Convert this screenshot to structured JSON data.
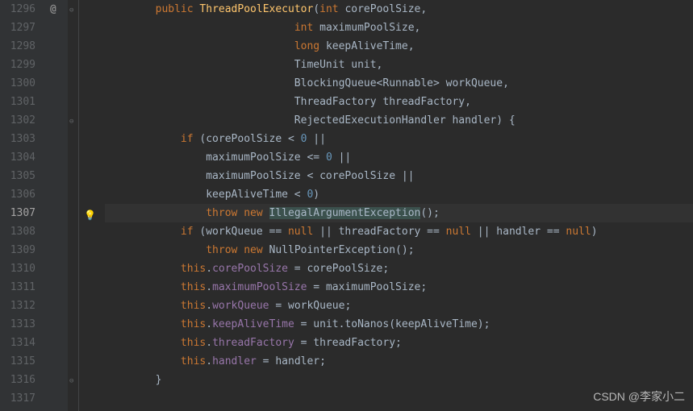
{
  "watermark": "CSDN @李家小二",
  "at_symbol": "@",
  "bulb_line": 1307,
  "current_line": 1307,
  "fold_marks": [
    {
      "line": 1296,
      "glyph": "⊖"
    },
    {
      "line": 1302,
      "glyph": "⊖"
    },
    {
      "line": 1316,
      "glyph": "⊖"
    }
  ],
  "lines": [
    {
      "n": 1296,
      "tokens": [
        [
          "",
          "        "
        ],
        [
          "kw",
          "public"
        ],
        [
          "",
          " "
        ],
        [
          "fn",
          "ThreadPoolExecutor"
        ],
        [
          "",
          "("
        ],
        [
          "kw",
          "int"
        ],
        [
          "",
          " corePoolSize"
        ],
        [
          "str",
          ","
        ]
      ]
    },
    {
      "n": 1297,
      "tokens": [
        [
          "",
          "                              "
        ],
        [
          "kw",
          "int"
        ],
        [
          "",
          " maximumPoolSize"
        ],
        [
          "str",
          ","
        ]
      ]
    },
    {
      "n": 1298,
      "tokens": [
        [
          "",
          "                              "
        ],
        [
          "kw",
          "long"
        ],
        [
          "",
          " keepAliveTime"
        ],
        [
          "str",
          ","
        ]
      ]
    },
    {
      "n": 1299,
      "tokens": [
        [
          "",
          "                              TimeUnit unit"
        ],
        [
          "str",
          ","
        ]
      ]
    },
    {
      "n": 1300,
      "tokens": [
        [
          "",
          "                              BlockingQueue<Runnable> workQueue"
        ],
        [
          "str",
          ","
        ]
      ]
    },
    {
      "n": 1301,
      "tokens": [
        [
          "",
          "                              ThreadFactory threadFactory"
        ],
        [
          "str",
          ","
        ]
      ]
    },
    {
      "n": 1302,
      "tokens": [
        [
          "",
          "                              RejectedExecutionHandler handler) {"
        ]
      ]
    },
    {
      "n": 1303,
      "tokens": [
        [
          "",
          "            "
        ],
        [
          "kw",
          "if"
        ],
        [
          "",
          " (corePoolSize < "
        ],
        [
          "nm",
          "0"
        ],
        [
          "",
          " ||"
        ]
      ]
    },
    {
      "n": 1304,
      "tokens": [
        [
          "",
          "                maximumPoolSize <= "
        ],
        [
          "nm",
          "0"
        ],
        [
          "",
          " ||"
        ]
      ]
    },
    {
      "n": 1305,
      "tokens": [
        [
          "",
          "                maximumPoolSize < corePoolSize ||"
        ]
      ]
    },
    {
      "n": 1306,
      "tokens": [
        [
          "",
          "                keepAliveTime < "
        ],
        [
          "nm",
          "0"
        ],
        [
          "",
          ")"
        ]
      ]
    },
    {
      "n": 1307,
      "tokens": [
        [
          "",
          "                "
        ],
        [
          "kw",
          "throw new"
        ],
        [
          "",
          " "
        ],
        [
          "hlw",
          "IllegalArgumentException"
        ],
        [
          "",
          "()"
        ],
        [
          "str",
          ";"
        ]
      ]
    },
    {
      "n": 1308,
      "tokens": [
        [
          "",
          "            "
        ],
        [
          "kw",
          "if"
        ],
        [
          "",
          " (workQueue == "
        ],
        [
          "kw",
          "null"
        ],
        [
          "",
          " || threadFactory == "
        ],
        [
          "kw",
          "null"
        ],
        [
          "",
          " || handler == "
        ],
        [
          "kw",
          "null"
        ],
        [
          "",
          ")"
        ]
      ]
    },
    {
      "n": 1309,
      "tokens": [
        [
          "",
          "                "
        ],
        [
          "kw",
          "throw new"
        ],
        [
          "",
          " NullPointerException()"
        ],
        [
          "str",
          ";"
        ]
      ]
    },
    {
      "n": 1310,
      "tokens": [
        [
          "",
          "            "
        ],
        [
          "kw",
          "this"
        ],
        [
          "",
          "."
        ],
        [
          "fld",
          "corePoolSize"
        ],
        [
          "",
          " = corePoolSize"
        ],
        [
          "str",
          ";"
        ]
      ]
    },
    {
      "n": 1311,
      "tokens": [
        [
          "",
          "            "
        ],
        [
          "kw",
          "this"
        ],
        [
          "",
          "."
        ],
        [
          "fld",
          "maximumPoolSize"
        ],
        [
          "",
          " = maximumPoolSize"
        ],
        [
          "str",
          ";"
        ]
      ]
    },
    {
      "n": 1312,
      "tokens": [
        [
          "",
          "            "
        ],
        [
          "kw",
          "this"
        ],
        [
          "",
          "."
        ],
        [
          "fld",
          "workQueue"
        ],
        [
          "",
          " = workQueue"
        ],
        [
          "str",
          ";"
        ]
      ]
    },
    {
      "n": 1313,
      "tokens": [
        [
          "",
          "            "
        ],
        [
          "kw",
          "this"
        ],
        [
          "",
          "."
        ],
        [
          "fld",
          "keepAliveTime"
        ],
        [
          "",
          " = unit.toNanos(keepAliveTime)"
        ],
        [
          "str",
          ";"
        ]
      ]
    },
    {
      "n": 1314,
      "tokens": [
        [
          "",
          "            "
        ],
        [
          "kw",
          "this"
        ],
        [
          "",
          "."
        ],
        [
          "fld",
          "threadFactory"
        ],
        [
          "",
          " = threadFactory"
        ],
        [
          "str",
          ";"
        ]
      ]
    },
    {
      "n": 1315,
      "tokens": [
        [
          "",
          "            "
        ],
        [
          "kw",
          "this"
        ],
        [
          "",
          "."
        ],
        [
          "fld",
          "handler"
        ],
        [
          "",
          " = handler"
        ],
        [
          "str",
          ";"
        ]
      ]
    },
    {
      "n": 1316,
      "tokens": [
        [
          "",
          "        }"
        ]
      ]
    },
    {
      "n": 1317,
      "tokens": [
        [
          "",
          ""
        ]
      ]
    }
  ]
}
